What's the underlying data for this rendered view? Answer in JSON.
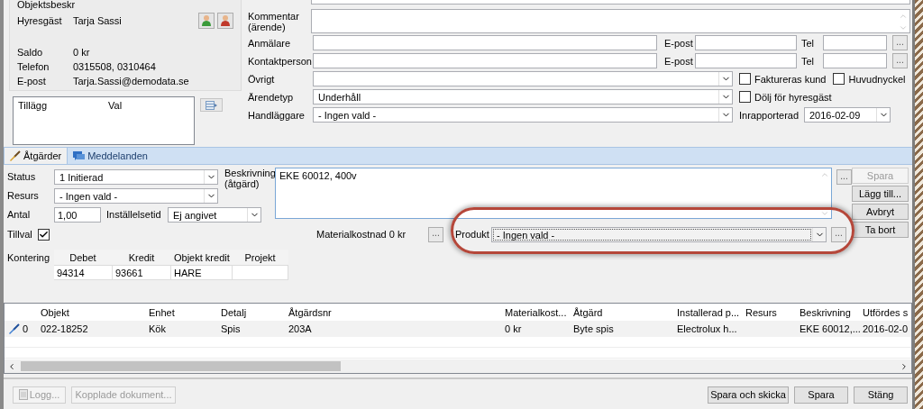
{
  "tenant_panel": {
    "title": "Objektsbeskr",
    "tenant": {
      "label": "Hyresgäst",
      "value": "Tarja Sassi"
    },
    "details": [
      {
        "label": "Saldo",
        "value": "0 kr"
      },
      {
        "label": "Telefon",
        "value": "0315508, 0310464"
      },
      {
        "label": "E-post",
        "value": "Tarja.Sassi@demodata.se"
      }
    ]
  },
  "addons_table": {
    "columns": [
      "Tillägg",
      "Val"
    ]
  },
  "case": {
    "comment_label": "Kommentar (ärende)",
    "contacts": [
      {
        "label": "Anmälare",
        "email_label": "E-post",
        "tel_label": "Tel",
        "button": "..."
      },
      {
        "label": "Kontaktperson",
        "email_label": "E-post",
        "tel_label": "Tel",
        "button": "..."
      }
    ],
    "selects": [
      {
        "label": "Övrigt",
        "extras": [
          {
            "kind": "checkbox",
            "label": "Faktureras kund",
            "checked": false
          },
          {
            "kind": "checkbox",
            "label": "Huvudnyckel",
            "checked": false
          }
        ]
      },
      {
        "label": "Ärendetyp",
        "value": "Underhåll",
        "extras": [
          {
            "kind": "checkbox",
            "label": "Dölj för hyresgäst",
            "checked": false
          }
        ]
      },
      {
        "label": "Handläggare",
        "value": "- Ingen vald -",
        "extras": [
          {
            "kind": "date",
            "label": "Inrapporterad",
            "value": "2016-02-09"
          }
        ]
      }
    ]
  },
  "tabs": [
    {
      "label": "Åtgärder",
      "selected": true
    },
    {
      "label": "Meddelanden",
      "selected": false
    }
  ],
  "action": {
    "status": {
      "label": "Status",
      "value": "1 Initierad"
    },
    "resource": {
      "label": "Resurs",
      "value": "- Ingen vald -"
    },
    "quantity": {
      "label": "Antal",
      "value": "1,00"
    },
    "setup_time": {
      "label": "Inställelsetid",
      "value": "Ej angivet"
    },
    "option": {
      "label": "Tillval",
      "checked": true
    },
    "description": {
      "label": "Beskrivning (åtgärd)",
      "value": "EKE 60012, 400v",
      "button": "..."
    },
    "material": {
      "label": "Materialkostnad 0 kr",
      "button": "..."
    },
    "product": {
      "label": "Produkt",
      "value": "- Ingen vald -",
      "button": "...",
      "highlighted": true
    },
    "accounting": {
      "label": "Kontering",
      "columns": [
        "Debet",
        "Kredit",
        "Objekt kredit",
        "Projekt"
      ],
      "row": [
        {
          "text": "94314"
        },
        {
          "text": "93661"
        },
        {
          "text": "HARE"
        }
      ]
    },
    "side_buttons": [
      {
        "label": "Spara",
        "disabled": true
      },
      {
        "label": "Lägg till...",
        "disabled": false
      },
      {
        "label": "Avbryt",
        "disabled": false
      },
      {
        "label": "Ta bort",
        "disabled": false
      }
    ]
  },
  "grid": {
    "columns": [
      "Objekt",
      "Enhet",
      "Detalj",
      "Åtgärdsnr",
      "Materialkost...",
      "Åtgärd",
      "Installerad p...",
      "Resurs",
      "Beskrivning",
      "Utfördes s"
    ],
    "rows": [
      {
        "indicator": "0",
        "cells": [
          {
            "text": "022-18252"
          },
          {
            "text": "Kök"
          },
          {
            "text": "Spis"
          },
          {
            "text": "203A"
          },
          {
            "text": "0 kr"
          },
          {
            "text": "Byte spis"
          },
          {
            "text": "Electrolux h..."
          },
          {},
          {
            "text": "EKE 60012,..."
          },
          {
            "text": "2016-02-0"
          }
        ]
      }
    ]
  },
  "footer": {
    "left_buttons": [
      {
        "label": "Logg...",
        "disabled": true,
        "icon": true
      },
      {
        "label": "Kopplade dokument...",
        "disabled": true,
        "icon": false
      }
    ],
    "right_buttons": [
      {
        "label": "Spara och skicka",
        "disabled": false
      },
      {
        "label": "Spara",
        "disabled": false
      },
      {
        "label": "Stäng",
        "disabled": false
      }
    ]
  }
}
